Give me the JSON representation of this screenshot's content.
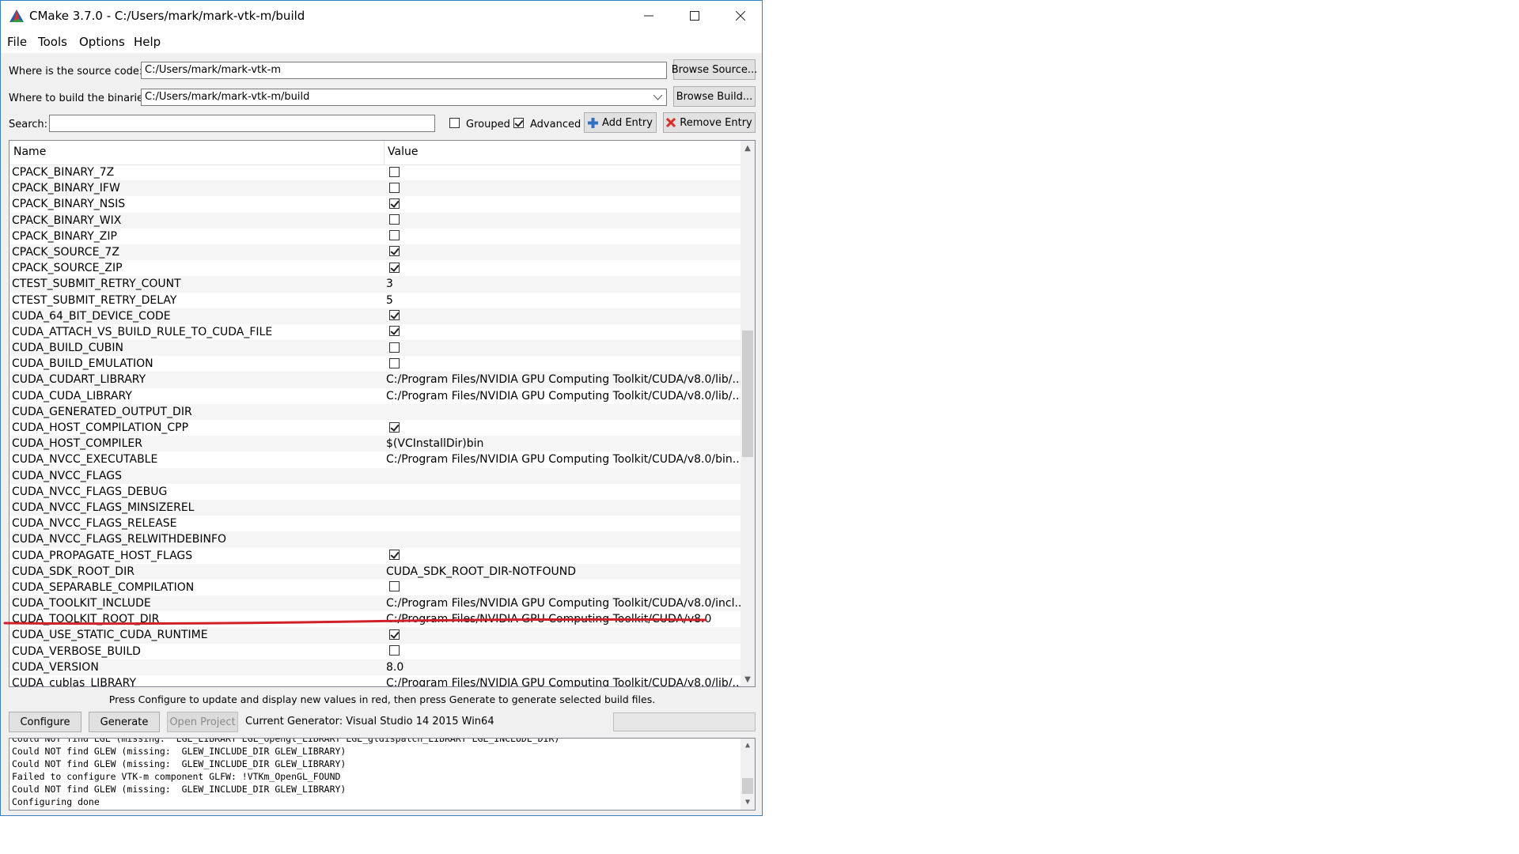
{
  "window": {
    "title": "CMake 3.7.0 - C:/Users/mark/mark-vtk-m/build",
    "icon": "cmake-triangle-icon",
    "controls": [
      "minimize-icon",
      "maximize-icon",
      "close-icon"
    ]
  },
  "menu": {
    "file": "File",
    "tools": "Tools",
    "options": "Options",
    "help": "Help"
  },
  "paths": {
    "source_label": "Where is the source code:",
    "source_value": "C:/Users/mark/mark-vtk-m",
    "browse_source": "Browse Source...",
    "build_label": "Where to build the binaries:",
    "build_value": "C:/Users/mark/mark-vtk-m/build",
    "browse_build": "Browse Build..."
  },
  "search": {
    "label": "Search:",
    "value": "",
    "grouped_label": "Grouped",
    "grouped_checked": false,
    "advanced_label": "Advanced",
    "advanced_checked": true,
    "add_entry": "Add Entry",
    "remove_entry": "Remove Entry"
  },
  "table": {
    "col_name": "Name",
    "col_value": "Value",
    "rows": [
      {
        "name": "CPACK_BINARY_7Z",
        "type": "bool",
        "checked": false
      },
      {
        "name": "CPACK_BINARY_IFW",
        "type": "bool",
        "checked": false
      },
      {
        "name": "CPACK_BINARY_NSIS",
        "type": "bool",
        "checked": true
      },
      {
        "name": "CPACK_BINARY_WIX",
        "type": "bool",
        "checked": false
      },
      {
        "name": "CPACK_BINARY_ZIP",
        "type": "bool",
        "checked": false
      },
      {
        "name": "CPACK_SOURCE_7Z",
        "type": "bool",
        "checked": true
      },
      {
        "name": "CPACK_SOURCE_ZIP",
        "type": "bool",
        "checked": true
      },
      {
        "name": "CTEST_SUBMIT_RETRY_COUNT",
        "type": "text",
        "value": "3"
      },
      {
        "name": "CTEST_SUBMIT_RETRY_DELAY",
        "type": "text",
        "value": "5"
      },
      {
        "name": "CUDA_64_BIT_DEVICE_CODE",
        "type": "bool",
        "checked": true
      },
      {
        "name": "CUDA_ATTACH_VS_BUILD_RULE_TO_CUDA_FILE",
        "type": "bool",
        "checked": true
      },
      {
        "name": "CUDA_BUILD_CUBIN",
        "type": "bool",
        "checked": false
      },
      {
        "name": "CUDA_BUILD_EMULATION",
        "type": "bool",
        "checked": false
      },
      {
        "name": "CUDA_CUDART_LIBRARY",
        "type": "text",
        "value": "C:/Program Files/NVIDIA GPU Computing Toolkit/CUDA/v8.0/lib/..."
      },
      {
        "name": "CUDA_CUDA_LIBRARY",
        "type": "text",
        "value": "C:/Program Files/NVIDIA GPU Computing Toolkit/CUDA/v8.0/lib/..."
      },
      {
        "name": "CUDA_GENERATED_OUTPUT_DIR",
        "type": "text",
        "value": ""
      },
      {
        "name": "CUDA_HOST_COMPILATION_CPP",
        "type": "bool",
        "checked": true
      },
      {
        "name": "CUDA_HOST_COMPILER",
        "type": "text",
        "value": "$(VCInstallDir)bin"
      },
      {
        "name": "CUDA_NVCC_EXECUTABLE",
        "type": "text",
        "value": "C:/Program Files/NVIDIA GPU Computing Toolkit/CUDA/v8.0/bin..."
      },
      {
        "name": "CUDA_NVCC_FLAGS",
        "type": "text",
        "value": ""
      },
      {
        "name": "CUDA_NVCC_FLAGS_DEBUG",
        "type": "text",
        "value": ""
      },
      {
        "name": "CUDA_NVCC_FLAGS_MINSIZEREL",
        "type": "text",
        "value": ""
      },
      {
        "name": "CUDA_NVCC_FLAGS_RELEASE",
        "type": "text",
        "value": ""
      },
      {
        "name": "CUDA_NVCC_FLAGS_RELWITHDEBINFO",
        "type": "text",
        "value": ""
      },
      {
        "name": "CUDA_PROPAGATE_HOST_FLAGS",
        "type": "bool",
        "checked": true
      },
      {
        "name": "CUDA_SDK_ROOT_DIR",
        "type": "text",
        "value": "CUDA_SDK_ROOT_DIR-NOTFOUND"
      },
      {
        "name": "CUDA_SEPARABLE_COMPILATION",
        "type": "bool",
        "checked": false
      },
      {
        "name": "CUDA_TOOLKIT_INCLUDE",
        "type": "text",
        "value": "C:/Program Files/NVIDIA GPU Computing Toolkit/CUDA/v8.0/incl..."
      },
      {
        "name": "CUDA_TOOLKIT_ROOT_DIR",
        "type": "text",
        "value": "C:/Program Files/NVIDIA GPU Computing Toolkit/CUDA/v8.0",
        "highlighted": true
      },
      {
        "name": "CUDA_USE_STATIC_CUDA_RUNTIME",
        "type": "bool",
        "checked": true
      },
      {
        "name": "CUDA_VERBOSE_BUILD",
        "type": "bool",
        "checked": false
      },
      {
        "name": "CUDA_VERSION",
        "type": "text",
        "value": "8.0"
      },
      {
        "name": "CUDA_cublas_LIBRARY",
        "type": "text",
        "value": "C:/Program Files/NVIDIA GPU Computing Toolkit/CUDA/v8.0/lib/..."
      }
    ]
  },
  "hint": "Press Configure to update and display new values in red, then press Generate to generate selected build files.",
  "actions": {
    "configure": "Configure",
    "generate": "Generate",
    "open_project": "Open Project",
    "generator": "Current Generator: Visual Studio 14 2015 Win64"
  },
  "log": [
    "Could NOT find EGL (missing:  EGL_LIBRARY EGL_opengl_LIBRARY EGL_gldispatch_LIBRARY EGL_INCLUDE_DIR)",
    "Could NOT find GLEW (missing:  GLEW_INCLUDE_DIR GLEW_LIBRARY)",
    "Could NOT find GLEW (missing:  GLEW_INCLUDE_DIR GLEW_LIBRARY)",
    "Failed to configure VTK-m component GLFW: !VTKm_OpenGL_FOUND",
    "Could NOT find GLEW (missing:  GLEW_INCLUDE_DIR GLEW_LIBRARY)",
    "Configuring done"
  ],
  "colors": {
    "accent_border": "#3b7fbf",
    "annotation_red": "#d0202a",
    "remove_x": "#d9302a",
    "add_plus": "#2f6fc4"
  }
}
